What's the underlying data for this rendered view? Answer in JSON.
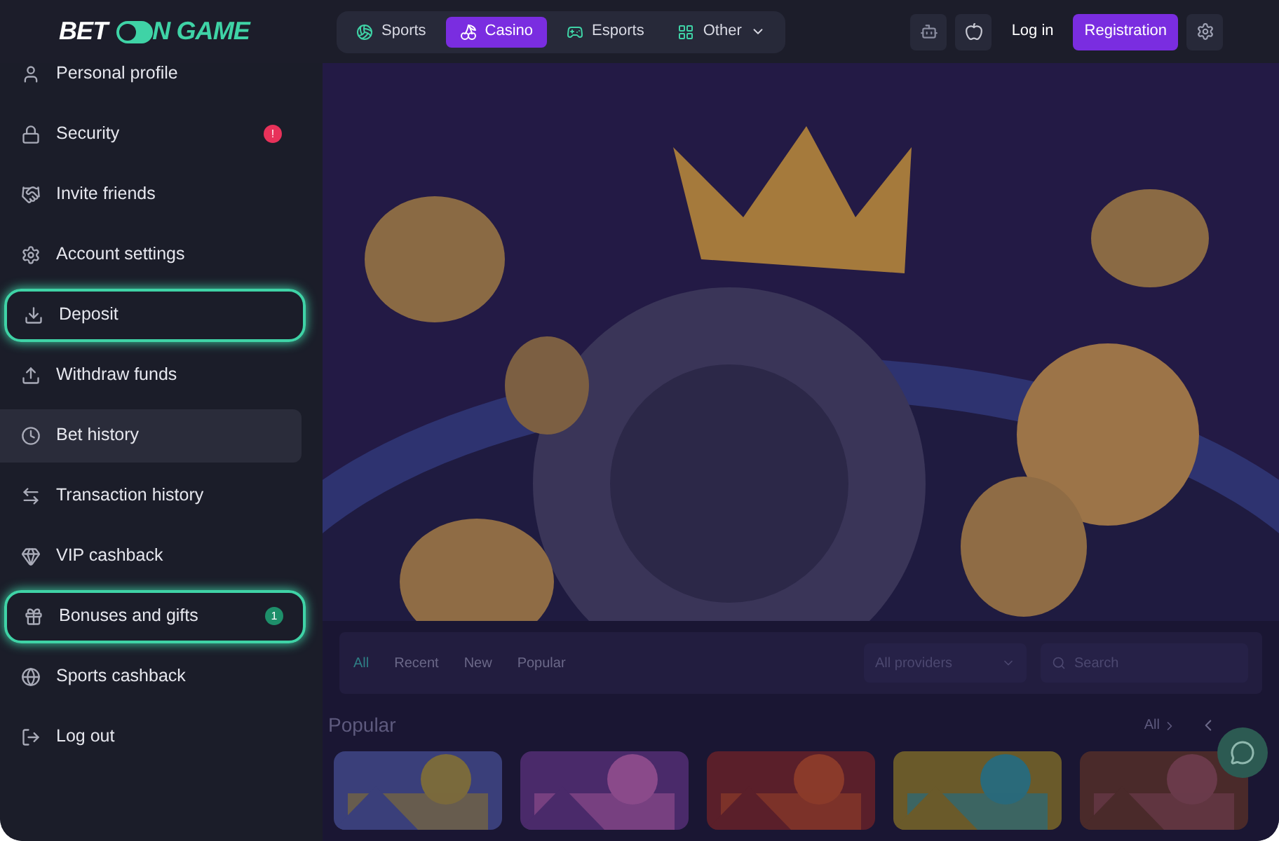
{
  "logo": {
    "left": "BET",
    "right": "N GAME"
  },
  "nav": [
    {
      "label": "Sports",
      "selected": false
    },
    {
      "label": "Casino",
      "selected": true
    },
    {
      "label": "Esports",
      "selected": false
    },
    {
      "label": "Other",
      "selected": false
    }
  ],
  "auth": {
    "login": "Log in",
    "register": "Registration"
  },
  "sidebar": {
    "items": [
      {
        "label": "Personal profile",
        "selected": false,
        "highlighted": false
      },
      {
        "label": "Security",
        "selected": false,
        "highlighted": false,
        "badge": {
          "text": "!",
          "color": "#e8325a"
        }
      },
      {
        "label": "Invite friends",
        "selected": false,
        "highlighted": false
      },
      {
        "label": "Account settings",
        "selected": false,
        "highlighted": false
      },
      {
        "label": "Deposit",
        "selected": false,
        "highlighted": true
      },
      {
        "label": "Withdraw funds",
        "selected": false,
        "highlighted": false
      },
      {
        "label": "Bet history",
        "selected": true,
        "highlighted": false
      },
      {
        "label": "Transaction history",
        "selected": false,
        "highlighted": false
      },
      {
        "label": "VIP cashback",
        "selected": false,
        "highlighted": false
      },
      {
        "label": "Bonuses and gifts",
        "selected": false,
        "highlighted": true,
        "badge": {
          "text": "1",
          "color": "#1e8f6a"
        }
      },
      {
        "label": "Sports cashback",
        "selected": false,
        "highlighted": false
      },
      {
        "label": "Log out",
        "selected": false,
        "highlighted": false
      }
    ]
  },
  "filters": [
    {
      "label": "All",
      "selected": true
    },
    {
      "label": "Recent",
      "selected": false
    },
    {
      "label": "New",
      "selected": false
    },
    {
      "label": "Popular",
      "selected": false
    }
  ],
  "providers": {
    "placeholder": "All providers"
  },
  "search": {
    "placeholder": "Search"
  },
  "section": {
    "title": "Popular",
    "all": "All"
  }
}
